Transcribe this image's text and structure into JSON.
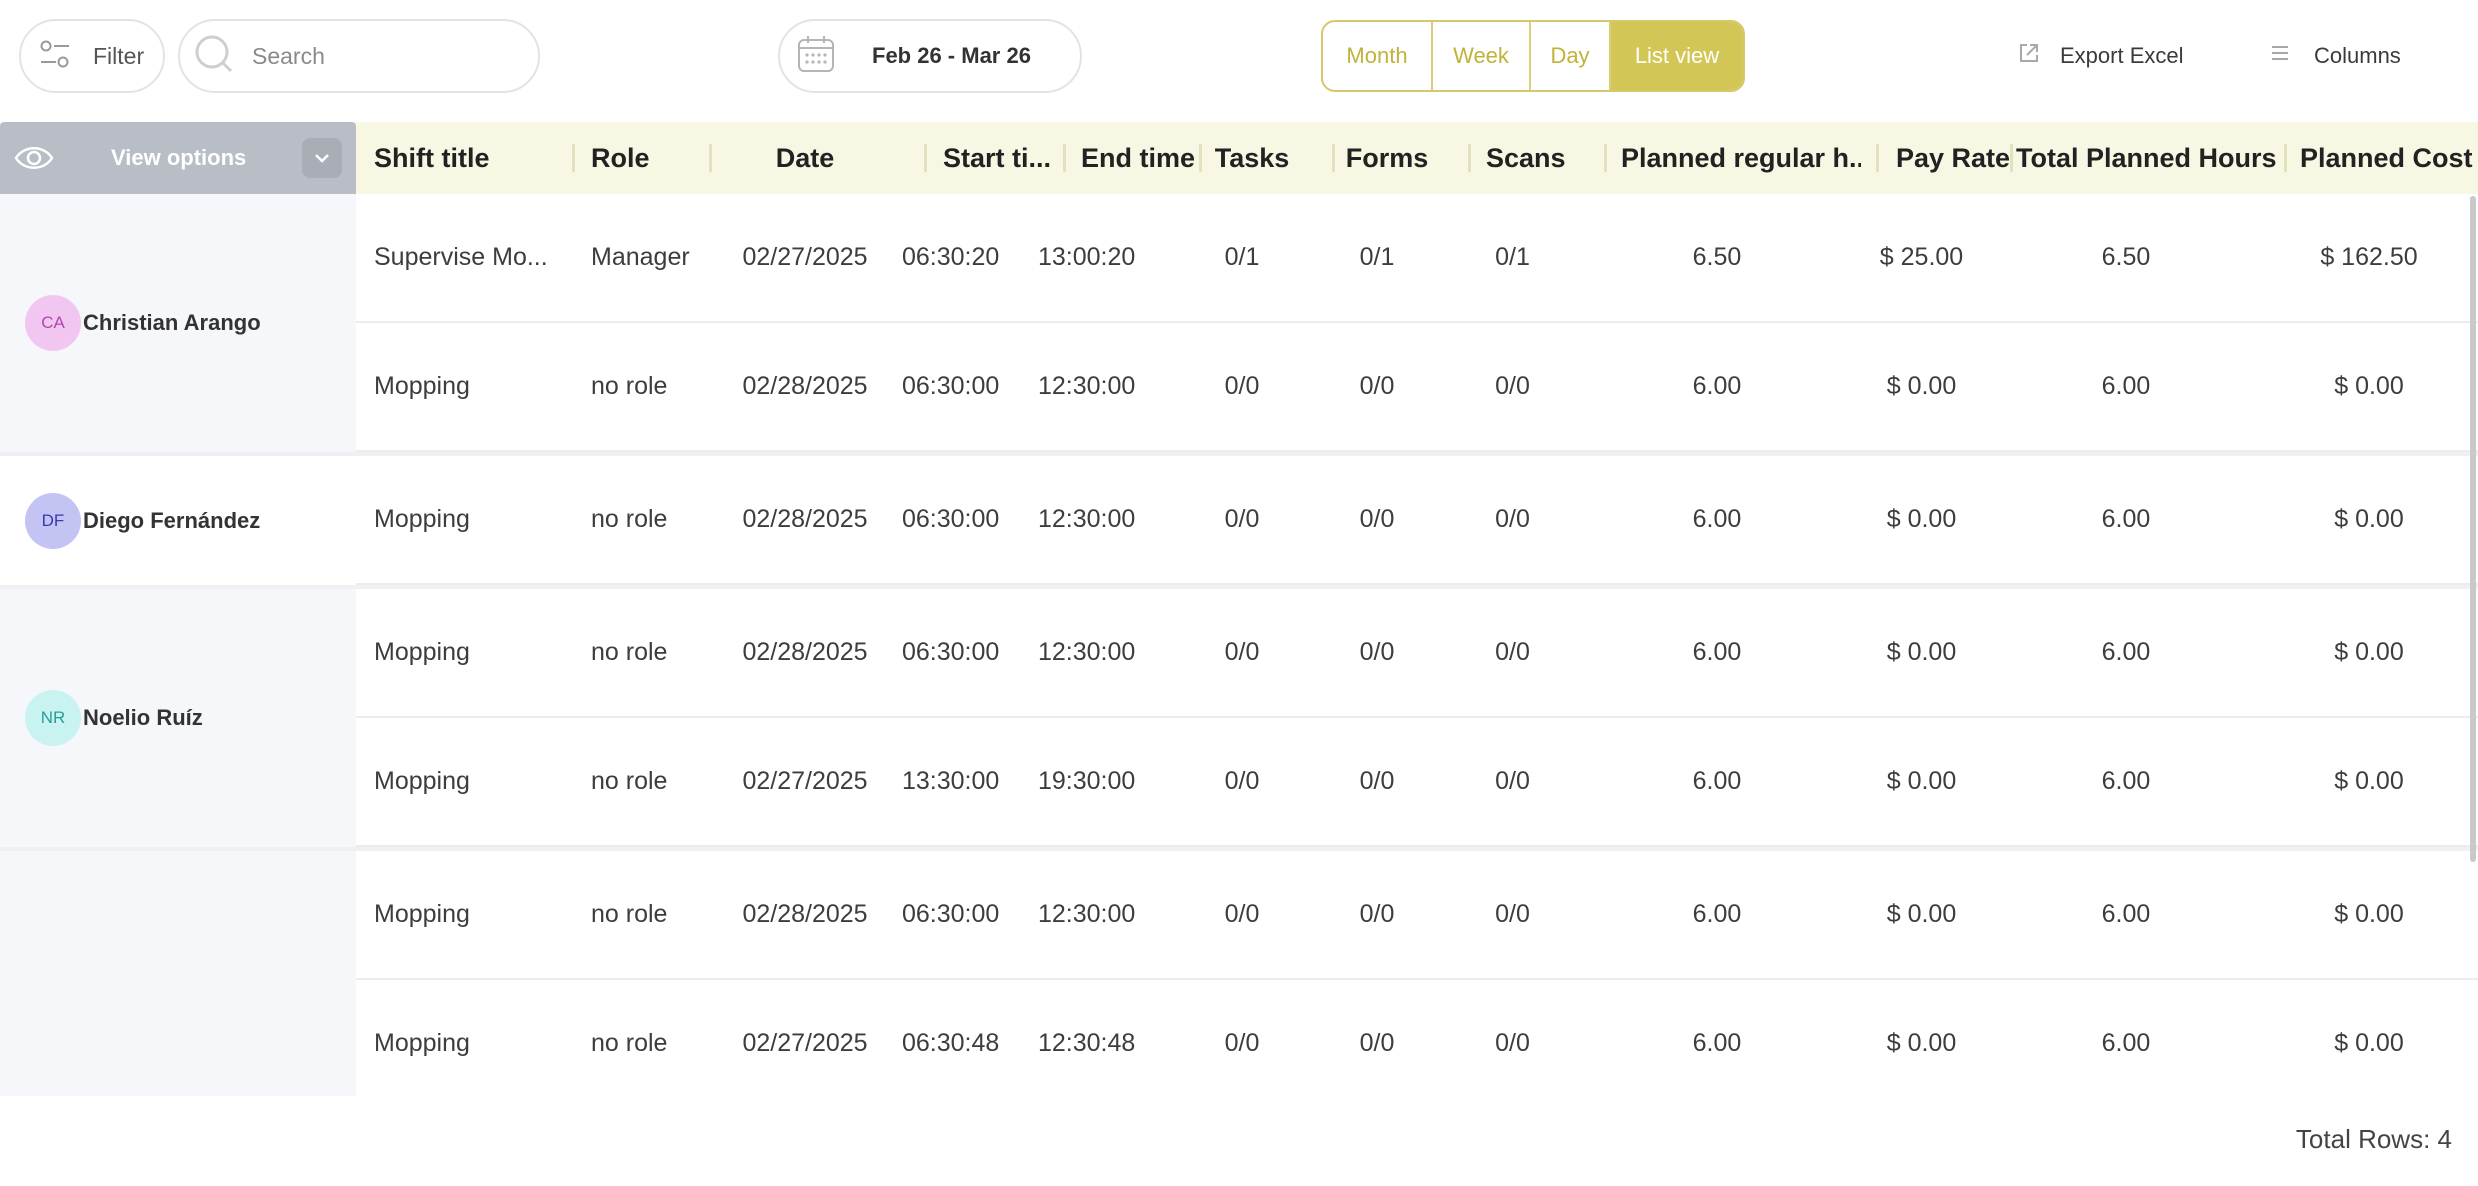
{
  "toolbar": {
    "filter_label": "Filter",
    "search_placeholder": "Search",
    "date_range": "Feb 26 - Mar 26",
    "views": [
      {
        "label": "Month",
        "active": false
      },
      {
        "label": "Week",
        "active": false
      },
      {
        "label": "Day",
        "active": false
      },
      {
        "label": "List view",
        "active": true
      }
    ],
    "export_label": "Export Excel",
    "columns_label": "Columns"
  },
  "view_options": {
    "label": "View options"
  },
  "columns": [
    "Shift title",
    "Role",
    "Date",
    "Start ti...",
    "End time",
    "Tasks",
    "Forms",
    "Scans",
    "Planned regular h...",
    "Pay Rate",
    "Total Planned Hours",
    "Planned Cost"
  ],
  "groups": [
    {
      "initials": "CA",
      "name": "Christian Arango",
      "avatar_bg": "#f1c6f0",
      "avatar_fg": "#b04aad",
      "rows": [
        [
          "Supervise Mo...",
          "Manager",
          "02/27/2025",
          "06:30:20",
          "13:00:20",
          "0/1",
          "0/1",
          "0/1",
          "6.50",
          "$ 25.00",
          "6.50",
          "$ 162.50"
        ],
        [
          "Mopping",
          "no role",
          "02/28/2025",
          "06:30:00",
          "12:30:00",
          "0/0",
          "0/0",
          "0/0",
          "6.00",
          "$ 0.00",
          "6.00",
          "$ 0.00"
        ]
      ]
    },
    {
      "initials": "DF",
      "name": "Diego Fernández",
      "avatar_bg": "#c3c4f3",
      "avatar_fg": "#3a3ab0",
      "rows": [
        [
          "Mopping",
          "no role",
          "02/28/2025",
          "06:30:00",
          "12:30:00",
          "0/0",
          "0/0",
          "0/0",
          "6.00",
          "$ 0.00",
          "6.00",
          "$ 0.00"
        ]
      ]
    },
    {
      "initials": "NR",
      "name": "Noelio Ruíz",
      "avatar_bg": "#c8f3f1",
      "avatar_fg": "#2a9d97",
      "rows": [
        [
          "Mopping",
          "no role",
          "02/28/2025",
          "06:30:00",
          "12:30:00",
          "0/0",
          "0/0",
          "0/0",
          "6.00",
          "$ 0.00",
          "6.00",
          "$ 0.00"
        ],
        [
          "Mopping",
          "no role",
          "02/27/2025",
          "13:30:00",
          "19:30:00",
          "0/0",
          "0/0",
          "0/0",
          "6.00",
          "$ 0.00",
          "6.00",
          "$ 0.00"
        ]
      ]
    },
    {
      "initials": "",
      "name": "",
      "avatar_bg": "#c9f2c3",
      "avatar_fg": "#3c9a33",
      "rows": [
        [
          "Mopping",
          "no role",
          "02/28/2025",
          "06:30:00",
          "12:30:00",
          "0/0",
          "0/0",
          "0/0",
          "6.00",
          "$ 0.00",
          "6.00",
          "$ 0.00"
        ],
        [
          "Mopping",
          "no role",
          "02/27/2025",
          "06:30:48",
          "12:30:48",
          "0/0",
          "0/0",
          "0/0",
          "6.00",
          "$ 0.00",
          "6.00",
          "$ 0.00"
        ]
      ]
    }
  ],
  "footer": {
    "total_rows": "Total Rows: 4"
  },
  "colors": {
    "accent": "#d2c656",
    "header_bg": "#f8f7e4",
    "view_options_bg": "#b9bec6"
  }
}
